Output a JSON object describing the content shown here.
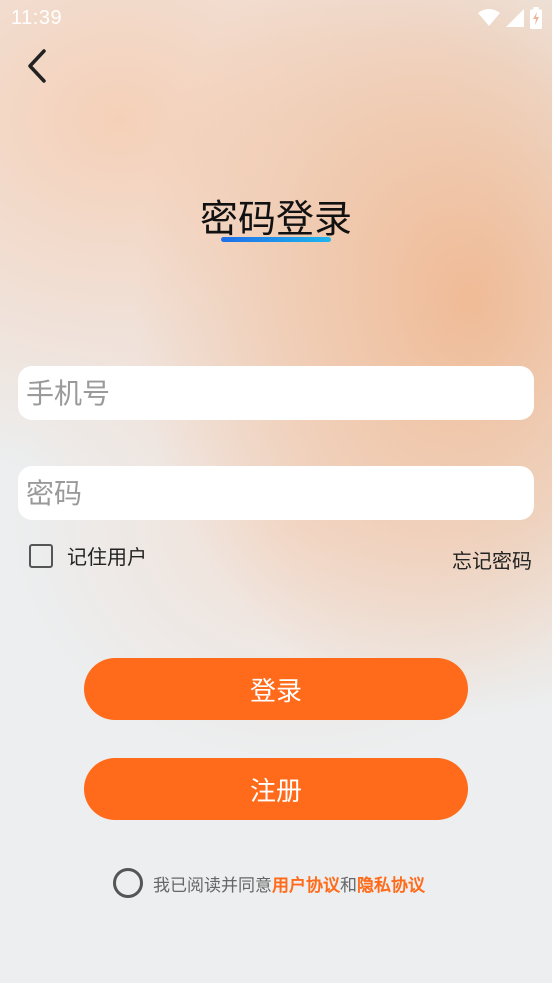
{
  "status_bar": {
    "time": "11:39",
    "icons": [
      "wifi-icon",
      "signal-icon",
      "battery-icon"
    ]
  },
  "header": {
    "back_icon": "chevron-left-icon"
  },
  "title": "密码登录",
  "form": {
    "phone_placeholder": "手机号",
    "password_placeholder": "密码",
    "remember_label": "记住用户",
    "forgot_label": "忘记密码"
  },
  "buttons": {
    "login_label": "登录",
    "register_label": "注册"
  },
  "agreement": {
    "prefix": "我已阅读并同意",
    "user_agreement": "用户协议",
    "conjunction": "和",
    "privacy_agreement": "隐私协议"
  },
  "colors": {
    "accent": "#ff6b1a",
    "underline_start": "#1e6ee8",
    "underline_end": "#1eb6ee"
  }
}
